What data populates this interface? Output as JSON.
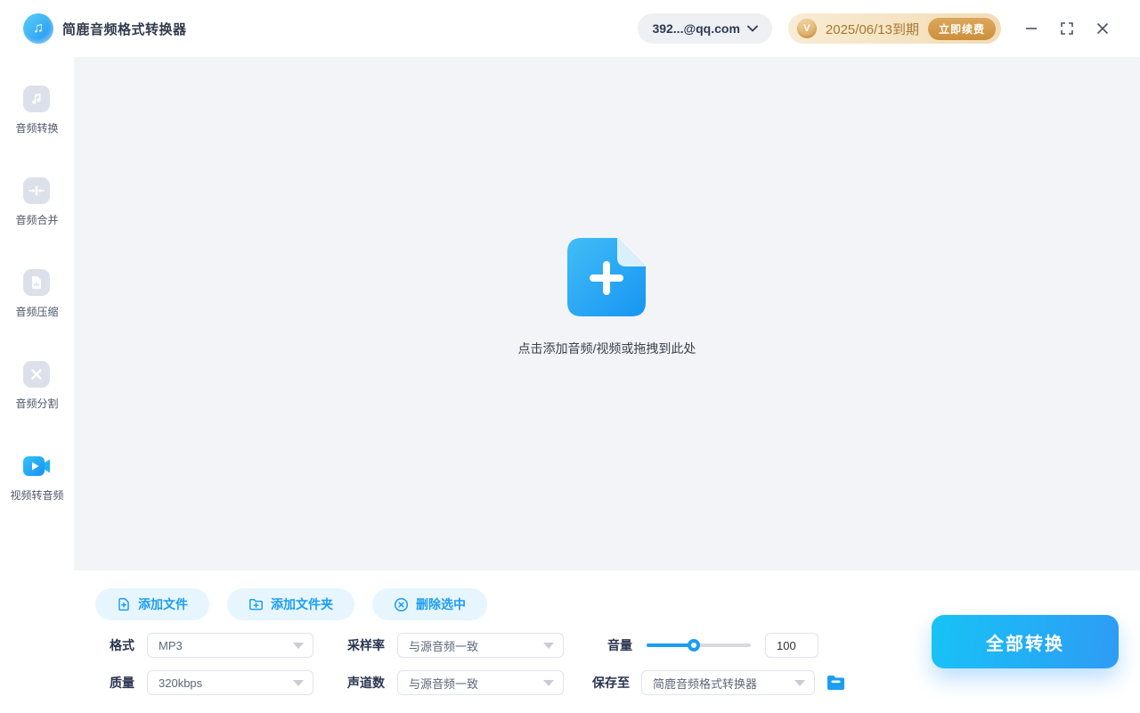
{
  "app": {
    "title": "简鹿音频格式转换器"
  },
  "header": {
    "account": "392...@qq.com",
    "vip_expiry": "2025/06/13到期",
    "vip_badge": "V",
    "renew_label": "立即续费"
  },
  "sidebar": {
    "items": [
      {
        "label": "音频转换",
        "icon": "music-note-icon",
        "active": false
      },
      {
        "label": "音频合并",
        "icon": "merge-icon",
        "active": false
      },
      {
        "label": "音频压缩",
        "icon": "compress-file-icon",
        "active": false
      },
      {
        "label": "音频分割",
        "icon": "scissors-icon",
        "active": false
      },
      {
        "label": "视频转音频",
        "icon": "video-camera-icon",
        "active": true
      }
    ]
  },
  "dropzone": {
    "hint": "点击添加音频/视频或拖拽到此处"
  },
  "toolbar": {
    "add_file": "添加文件",
    "add_folder": "添加文件夹",
    "delete_selected": "删除选中"
  },
  "settings": {
    "format": {
      "label": "格式",
      "value": "MP3"
    },
    "sample_rate": {
      "label": "采样率",
      "value": "与源音频一致"
    },
    "volume": {
      "label": "音量",
      "value": "100",
      "percent": 45
    },
    "quality": {
      "label": "质量",
      "value": "320kbps"
    },
    "channels": {
      "label": "声道数",
      "value": "与源音频一致"
    },
    "save_to": {
      "label": "保存至",
      "value": "简鹿音频格式转换器"
    }
  },
  "actions": {
    "convert_all": "全部转换"
  },
  "colors": {
    "primary": "#1b9df3",
    "convert_gradient_start": "#17c3f6",
    "convert_gradient_end": "#2e9bf5",
    "vip_text": "#a8772f",
    "light_button_bg": "#e7f6fe",
    "content_bg": "#f2f4f7"
  }
}
